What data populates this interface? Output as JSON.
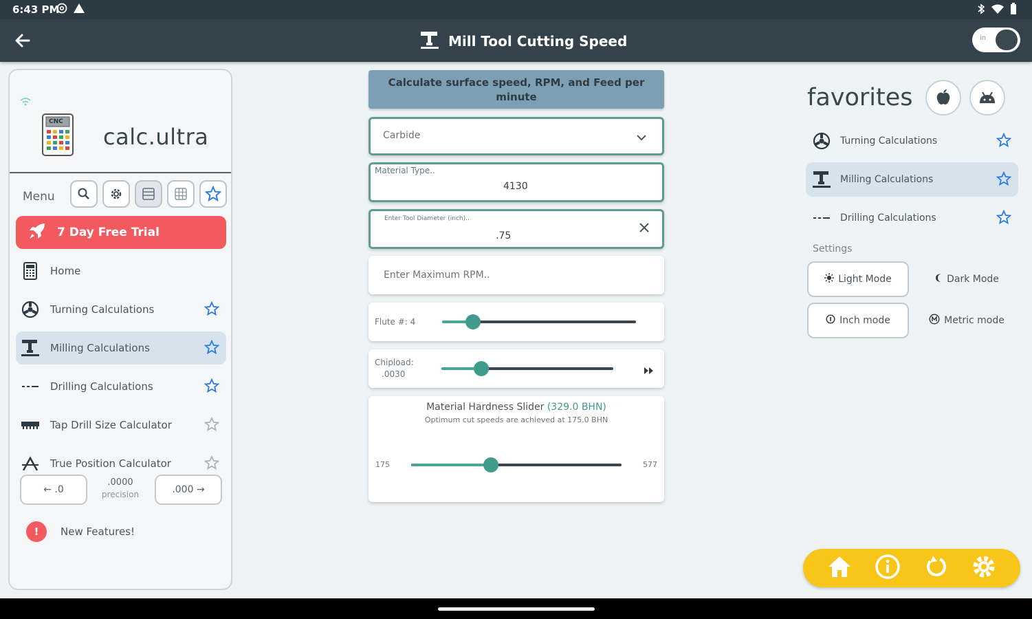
{
  "status_bar": {
    "time": "6:43 PM"
  },
  "app_bar": {
    "title": "Mill Tool Cutting Speed",
    "unit_toggle_label": "in"
  },
  "sidebar": {
    "brand": "calc.ultra",
    "logo_text": "CNC",
    "menu_label": "Menu",
    "trial_label": "7 Day Free Trial",
    "items": [
      {
        "label": "Home",
        "starred": false
      },
      {
        "label": "Turning Calculations",
        "starred": true
      },
      {
        "label": "Milling Calculations",
        "starred": true,
        "active": true
      },
      {
        "label": "Drilling Calculations",
        "starred": true
      },
      {
        "label": "Tap Drill Size Calculator",
        "starred": false
      },
      {
        "label": "True Position Calculator",
        "starred": false
      }
    ],
    "precision": {
      "decrease_label": "← .0",
      "value": ".0000",
      "caption": "precision",
      "increase_label": ".000 →"
    },
    "new_features_label": "New Features!"
  },
  "main": {
    "banner": "Calculate surface speed, RPM, and Feed per minute",
    "tool_material": {
      "value": "Carbide"
    },
    "material_type": {
      "label": "Material Type..",
      "value": "4130"
    },
    "tool_diameter": {
      "label": "Enter Tool Diameter (inch)..",
      "value": ".75"
    },
    "max_rpm": {
      "placeholder": "Enter Maximum RPM.."
    },
    "flutes": {
      "label": "Flute #: 4",
      "position": 0.16
    },
    "chipload": {
      "label_line1": "Chipload:",
      "label_line2": ".0030",
      "position": 0.23
    },
    "hardness": {
      "title": "Material Hardness Slider ",
      "value_text": "(329.0 BHN)",
      "subtitle": "Optimum cut speeds are achieved at 175.0 BHN",
      "min": "175",
      "max": "577",
      "position": 0.38
    }
  },
  "favorites": {
    "title": "favorites",
    "items": [
      {
        "label": "Turning Calculations"
      },
      {
        "label": "Milling Calculations",
        "active": true
      },
      {
        "label": "Drilling Calculations"
      }
    ],
    "settings_label": "Settings",
    "light_mode": "Light Mode",
    "dark_mode": "Dark Mode",
    "inch_mode": "Inch mode",
    "metric_mode": "Metric mode"
  },
  "colors": {
    "app_bar": "#34424c",
    "accent": "#3f9c8c",
    "trial": "#f25a5f",
    "bottom_bar": "#f7c619",
    "star": "#2f7de0"
  }
}
